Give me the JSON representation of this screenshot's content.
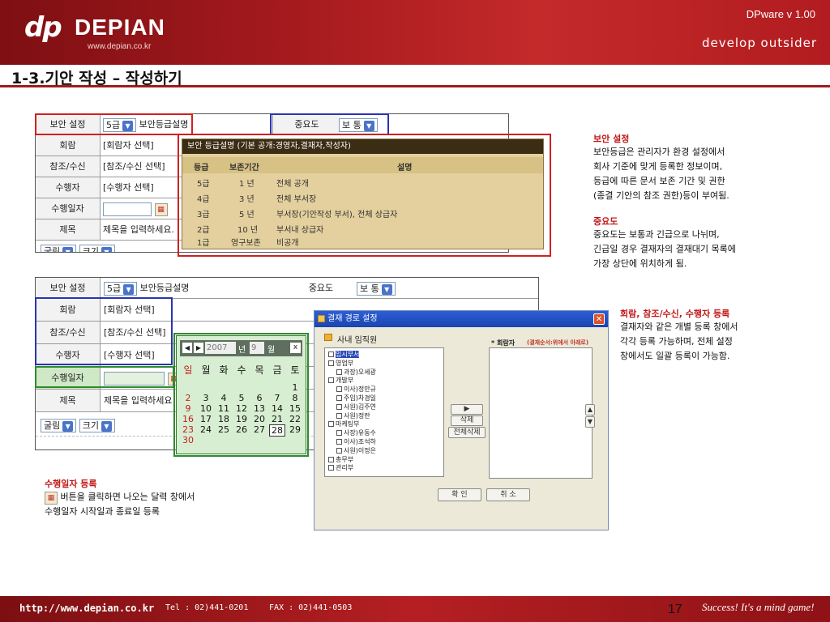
{
  "header": {
    "logo_badge": "dp",
    "logo_name": "DEPIAN",
    "logo_url": "www.depian.co.kr",
    "version": "DPware v 1.00",
    "slogan": "develop outsider"
  },
  "page_title": "1-3.기안 작성 – 작성하기",
  "form1": {
    "rows": [
      {
        "label": "보안 설정",
        "value": "5급",
        "extra": "보안등급설명"
      },
      {
        "label": "회람",
        "value": "[회람자 선택]"
      },
      {
        "label": "참조/수신",
        "value": "[참조/수신 선택]"
      },
      {
        "label": "수행자",
        "value": "[수행자 선택]"
      },
      {
        "label": "수행일자",
        "value": ""
      },
      {
        "label": "제목",
        "value": "제목을 입력하세요."
      }
    ],
    "importance_label": "중요도",
    "importance_value": "보 통",
    "toolbar_font": "굴림",
    "toolbar_size": "크기"
  },
  "security_popup": {
    "title": "보안 등급설명 (기본 공개:경영자,결재자,작성자)",
    "col_grade": "등급",
    "col_period": "보존기간",
    "col_desc": "설명",
    "rows": [
      {
        "grade": "5급",
        "period": "1 년",
        "desc": "전체 공개"
      },
      {
        "grade": "4급",
        "period": "3 년",
        "desc": "전체 부서장"
      },
      {
        "grade": "3급",
        "period": "5 년",
        "desc": "부서장(기안작성 부서), 전체 상급자"
      },
      {
        "grade": "2급",
        "period": "10 년",
        "desc": "부서내 상급자"
      },
      {
        "grade": "1급",
        "period": "영구보존",
        "desc": "비공개"
      }
    ]
  },
  "form2": {
    "rows": [
      {
        "label": "보안 설정",
        "value": "5급",
        "extra": "보안등급설명"
      },
      {
        "label": "회람",
        "value": "[회람자 선택]"
      },
      {
        "label": "참조/수신",
        "value": "[참조/수신 선택]"
      },
      {
        "label": "수행자",
        "value": "[수행자 선택]"
      },
      {
        "label": "수행일자",
        "value": ""
      },
      {
        "label": "제목",
        "value": "제목을 입력하세요"
      }
    ],
    "importance_label": "중요도",
    "importance_value": "보 통",
    "toolbar_font": "굴림",
    "toolbar_size": "크기"
  },
  "calendar": {
    "year": "2007",
    "year_suffix": "년",
    "month": "9",
    "month_suffix": "월",
    "close": "x",
    "weekdays": [
      "일",
      "월",
      "화",
      "수",
      "목",
      "금",
      "토"
    ],
    "days": [
      "1",
      "2",
      "3",
      "4",
      "5",
      "6",
      "7",
      "8",
      "9",
      "10",
      "11",
      "12",
      "13",
      "14",
      "15",
      "16",
      "17",
      "18",
      "19",
      "20",
      "21",
      "22",
      "23",
      "24",
      "25",
      "26",
      "27",
      "28",
      "29",
      "30"
    ],
    "first_weekday": 6,
    "selected": "28"
  },
  "dialog": {
    "title": "결재 경로 설정",
    "tree_root": "사내 임직원",
    "tree": [
      {
        "label": "임시부서",
        "level": 0,
        "selected": true
      },
      {
        "label": "영업부",
        "level": 0
      },
      {
        "label": "과장)오세광",
        "level": 1
      },
      {
        "label": "개발부",
        "level": 0
      },
      {
        "label": "이사)정만규",
        "level": 1
      },
      {
        "label": "주임)차경일",
        "level": 1
      },
      {
        "label": "사원)김주연",
        "level": 1
      },
      {
        "label": "사원)정란",
        "level": 1
      },
      {
        "label": "마케팅부",
        "level": 0
      },
      {
        "label": "사장)유동수",
        "level": 1
      },
      {
        "label": "이사)조석하",
        "level": 1
      },
      {
        "label": "사원)이정은",
        "level": 1
      },
      {
        "label": "총무부",
        "level": 0
      },
      {
        "label": "관리부",
        "level": 0
      }
    ],
    "receiver_label": "* 회람자",
    "receiver_hint": "(결재순서:위에서 아래로)",
    "btn_add": "▶",
    "btn_delete": "삭제",
    "btn_delete_all": "전체삭제",
    "btn_ok": "확 인",
    "btn_cancel": "취 소"
  },
  "notes": {
    "security_head": "보안 설정",
    "security_body": [
      "보안등급은 관리자가 환경 설정에서",
      "회사 기준에 맞게 등록한 정보이며,",
      "등급에 따른 문서 보존 기간 및 권한",
      "(종결 기안의 참조 권한)등이 부여됨."
    ],
    "importance_head": "중요도",
    "importance_body": [
      "중요도는 보통과 긴급으로 나뉘며,",
      "긴급일 경우 결재자의 결재대기 목록에",
      "가장 상단에 위치하게 됨."
    ],
    "register_head": "회람, 참조/수신, 수행자 등록",
    "register_body": [
      "결재자와 같은 개별 등록 창에서",
      "각각 등록 가능하며, 전체 설정",
      "창에서도 일괄 등록이 가능함."
    ],
    "date_head": "수행일자 등록",
    "date_body": [
      "버튼을 클릭하면 나오는 달력 창에서",
      "수행일자 시작일과 종료일 등록"
    ]
  },
  "footer": {
    "url": "http://www.depian.co.kr",
    "tel": "Tel : 02)441-0201",
    "fax": "FAX : 02)441-0503",
    "page": "17",
    "slogan": "Success! It's a mind game!"
  }
}
